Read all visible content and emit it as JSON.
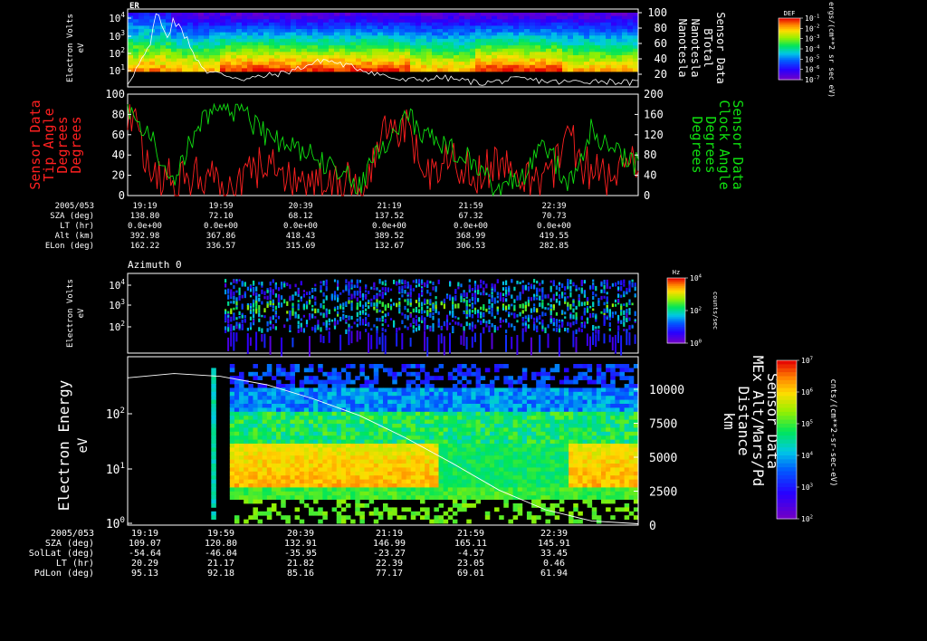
{
  "colors": {
    "background": "#000000",
    "white": "#ffffff",
    "red": "#ff2020",
    "green": "#10e010"
  },
  "panel1": {
    "title": "ER",
    "ylabel": "Electron Volts",
    "yunit": "eV",
    "ytick_labels": [
      "10^4",
      "10^3",
      "10^2",
      "10^1"
    ],
    "right_ticks": [
      "100",
      "80",
      "60",
      "40",
      "20"
    ],
    "right_labels": [
      "Sensor Data",
      "BTotal",
      "Nanotesla",
      "Nanotesla"
    ],
    "cb_title": "DEF",
    "cb_unit": "ergs/(cm**2 sr sec eV)",
    "cb_ticks": [
      "10^-1",
      "10^-2",
      "10^-3",
      "10^-4",
      "10^-5",
      "10^-6",
      "10^-7"
    ]
  },
  "panel2": {
    "left_ticks": [
      "100",
      "80",
      "60",
      "40",
      "20",
      "0"
    ],
    "right_ticks": [
      "200",
      "160",
      "120",
      "80",
      "40",
      "0"
    ],
    "left_labels": [
      "Sensor Data",
      "Tip Angle",
      "Degrees",
      "Degrees"
    ],
    "right_labels": [
      "Sensor Data",
      "Clock Angle",
      "Degrees",
      "Degrees"
    ]
  },
  "table1": {
    "date": "2005/053",
    "times": [
      "19:19",
      "19:59",
      "20:39",
      "21:19",
      "21:59",
      "22:39"
    ],
    "rows": [
      {
        "label": "SZA (deg)",
        "values": [
          "138.80",
          "72.10",
          "68.12",
          "137.52",
          "67.32",
          "70.73"
        ]
      },
      {
        "label": "LT (hr)",
        "values": [
          "0.0e+00",
          "0.0e+00",
          "0.0e+00",
          "0.0e+00",
          "0.0e+00",
          "0.0e+00"
        ]
      },
      {
        "label": "Alt (km)",
        "values": [
          "392.98",
          "367.86",
          "418.43",
          "389.52",
          "368.99",
          "419.55"
        ]
      },
      {
        "label": "ELon (deg)",
        "values": [
          "162.22",
          "336.57",
          "315.69",
          "132.67",
          "306.53",
          "282.85"
        ]
      }
    ]
  },
  "panel3": {
    "title": "Azimuth 0",
    "ylabel": "Electron Volts",
    "yunit": "eV",
    "ytick_labels": [
      "10^4",
      "10^3",
      "10^2"
    ],
    "cb_title": "Hz",
    "cb_unit": "counts/sec",
    "cb_ticks": [
      "10^4",
      "10^2",
      "10^0"
    ]
  },
  "panel4": {
    "ylabel": "Electron Energy",
    "yunit": "eV",
    "ytick_labels": [
      "10^2",
      "10^1",
      "10^0"
    ],
    "right_ticks": [
      "10000",
      "7500",
      "5000",
      "2500",
      "0"
    ],
    "right_labels": [
      "Sensor Data",
      "MEx Alt/Mars/Pd",
      "Distance",
      "km"
    ],
    "cb_unit": "cnts/(cm**2-sr-sec-eV)",
    "cb_ticks": [
      "10^7",
      "10^6",
      "10^5",
      "10^4",
      "10^3",
      "10^2"
    ]
  },
  "table2": {
    "date": "2005/053",
    "times": [
      "19:19",
      "19:59",
      "20:39",
      "21:19",
      "21:59",
      "22:39"
    ],
    "rows": [
      {
        "label": "SZA (deg)",
        "values": [
          "109.07",
          "120.80",
          "132.91",
          "146.99",
          "165.11",
          "145.91"
        ]
      },
      {
        "label": "SolLat (deg)",
        "values": [
          "-54.64",
          "-46.04",
          "-35.95",
          "-23.27",
          "-4.57",
          "33.45"
        ]
      },
      {
        "label": "LT (hr)",
        "values": [
          "20.29",
          "21.17",
          "21.82",
          "22.39",
          "23.05",
          "0.46"
        ]
      },
      {
        "label": "PdLon (deg)",
        "values": [
          "95.13",
          "92.18",
          "85.16",
          "77.17",
          "69.01",
          "61.94"
        ]
      }
    ]
  },
  "chart_data": [
    {
      "type": "heatmap",
      "name": "ER electron spectrogram",
      "ylabel": "Electron Volts",
      "yunit": "eV",
      "yscale": "log",
      "ylim": [
        1,
        30000
      ]
    },
    {
      "type": "line",
      "series": [
        {
          "name": "BTotal",
          "x": [
            "19:19",
            "19:25",
            "19:35",
            "19:45",
            "19:59",
            "20:15",
            "20:39",
            "21:00",
            "21:19",
            "21:40",
            "21:59",
            "22:20",
            "22:39",
            "22:55"
          ],
          "values": [
            5,
            88,
            20,
            10,
            18,
            35,
            22,
            8,
            12,
            5,
            10,
            6,
            8,
            5
          ]
        }
      ],
      "ylim": [
        0,
        100
      ],
      "ylabel": "Nanotesla"
    },
    {
      "type": "line",
      "xlim": [
        "19:19",
        "22:59"
      ],
      "series": [
        {
          "name": "Tip Angle",
          "color": "#ff2020",
          "x": [
            "19:19",
            "19:29",
            "19:39",
            "19:49",
            "19:59",
            "20:09",
            "20:19",
            "20:29",
            "20:39",
            "20:49",
            "20:59",
            "21:09",
            "21:19",
            "21:29",
            "21:39",
            "21:49",
            "21:59",
            "22:09",
            "22:19",
            "22:29",
            "22:39",
            "22:49",
            "22:59"
          ],
          "values": [
            80,
            30,
            10,
            25,
            5,
            15,
            35,
            20,
            10,
            15,
            8,
            60,
            70,
            15,
            40,
            20,
            35,
            10,
            15,
            55,
            20,
            15,
            40
          ],
          "ylim": [
            0,
            100
          ]
        },
        {
          "name": "Clock Angle",
          "color": "#10e010",
          "x": [
            "19:19",
            "19:29",
            "19:39",
            "19:49",
            "19:59",
            "20:09",
            "20:19",
            "20:29",
            "20:39",
            "20:49",
            "20:59",
            "21:09",
            "21:19",
            "21:29",
            "21:39",
            "21:49",
            "21:59",
            "22:09",
            "22:19",
            "22:29",
            "22:39",
            "22:49",
            "22:59"
          ],
          "values": [
            170,
            110,
            20,
            140,
            175,
            160,
            120,
            100,
            80,
            50,
            20,
            100,
            160,
            110,
            90,
            60,
            10,
            40,
            100,
            20,
            130,
            90,
            60
          ],
          "ylim": [
            0,
            200
          ]
        }
      ]
    },
    {
      "type": "heatmap",
      "name": "Azimuth 0",
      "yscale": "log",
      "yunit": "eV"
    },
    {
      "type": "heatmap",
      "name": "Electron Energy",
      "yscale": "log",
      "ylim": [
        1,
        500
      ],
      "yunit": "eV"
    },
    {
      "type": "line",
      "name": "MEx Alt/Mars/Pd",
      "x": [
        "19:19",
        "19:39",
        "19:59",
        "20:19",
        "20:39",
        "20:59",
        "21:19",
        "21:39",
        "21:59",
        "22:19",
        "22:39",
        "22:59"
      ],
      "values": [
        10500,
        10800,
        10600,
        10000,
        9000,
        7800,
        6200,
        4400,
        2500,
        1100,
        300,
        100
      ],
      "ylim": [
        0,
        12000
      ],
      "ylabel": "km"
    }
  ]
}
